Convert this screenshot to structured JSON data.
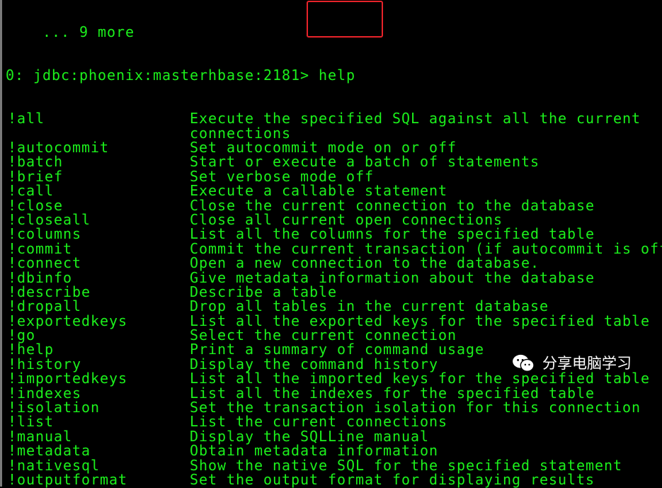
{
  "terminal": {
    "pre_line": "    ... 9 more",
    "prompt": "0: jdbc:phoenix:masterhbase:2181> ",
    "command": "help",
    "commands": [
      {
        "name": "!all",
        "desc": "Execute the specified SQL against all the current"
      },
      {
        "name": "",
        "desc": "connections"
      },
      {
        "name": "!autocommit",
        "desc": "Set autocommit mode on or off"
      },
      {
        "name": "!batch",
        "desc": "Start or execute a batch of statements"
      },
      {
        "name": "!brief",
        "desc": "Set verbose mode off"
      },
      {
        "name": "!call",
        "desc": "Execute a callable statement"
      },
      {
        "name": "!close",
        "desc": "Close the current connection to the database"
      },
      {
        "name": "!closeall",
        "desc": "Close all current open connections"
      },
      {
        "name": "!columns",
        "desc": "List all the columns for the specified table"
      },
      {
        "name": "!commit",
        "desc": "Commit the current transaction (if autocommit is off)"
      },
      {
        "name": "!connect",
        "desc": "Open a new connection to the database."
      },
      {
        "name": "!dbinfo",
        "desc": "Give metadata information about the database"
      },
      {
        "name": "!describe",
        "desc": "Describe a table"
      },
      {
        "name": "!dropall",
        "desc": "Drop all tables in the current database"
      },
      {
        "name": "!exportedkeys",
        "desc": "List all the exported keys for the specified table"
      },
      {
        "name": "!go",
        "desc": "Select the current connection"
      },
      {
        "name": "!help",
        "desc": "Print a summary of command usage"
      },
      {
        "name": "!history",
        "desc": "Display the command history"
      },
      {
        "name": "!importedkeys",
        "desc": "List all the imported keys for the specified table"
      },
      {
        "name": "!indexes",
        "desc": "List all the indexes for the specified table"
      },
      {
        "name": "!isolation",
        "desc": "Set the transaction isolation for this connection"
      },
      {
        "name": "!list",
        "desc": "List the current connections"
      },
      {
        "name": "!manual",
        "desc": "Display the SQLLine manual"
      },
      {
        "name": "!metadata",
        "desc": "Obtain metadata information"
      },
      {
        "name": "!nativesql",
        "desc": "Show the native SQL for the specified statement"
      },
      {
        "name": "!outputformat",
        "desc": "Set the output format for displaying results"
      }
    ]
  },
  "watermark": {
    "text": "分享电脑学习",
    "icon": "wechat-icon"
  },
  "colors": {
    "text": "#1cf01c",
    "background": "#000000",
    "highlight": "#e8232a"
  }
}
